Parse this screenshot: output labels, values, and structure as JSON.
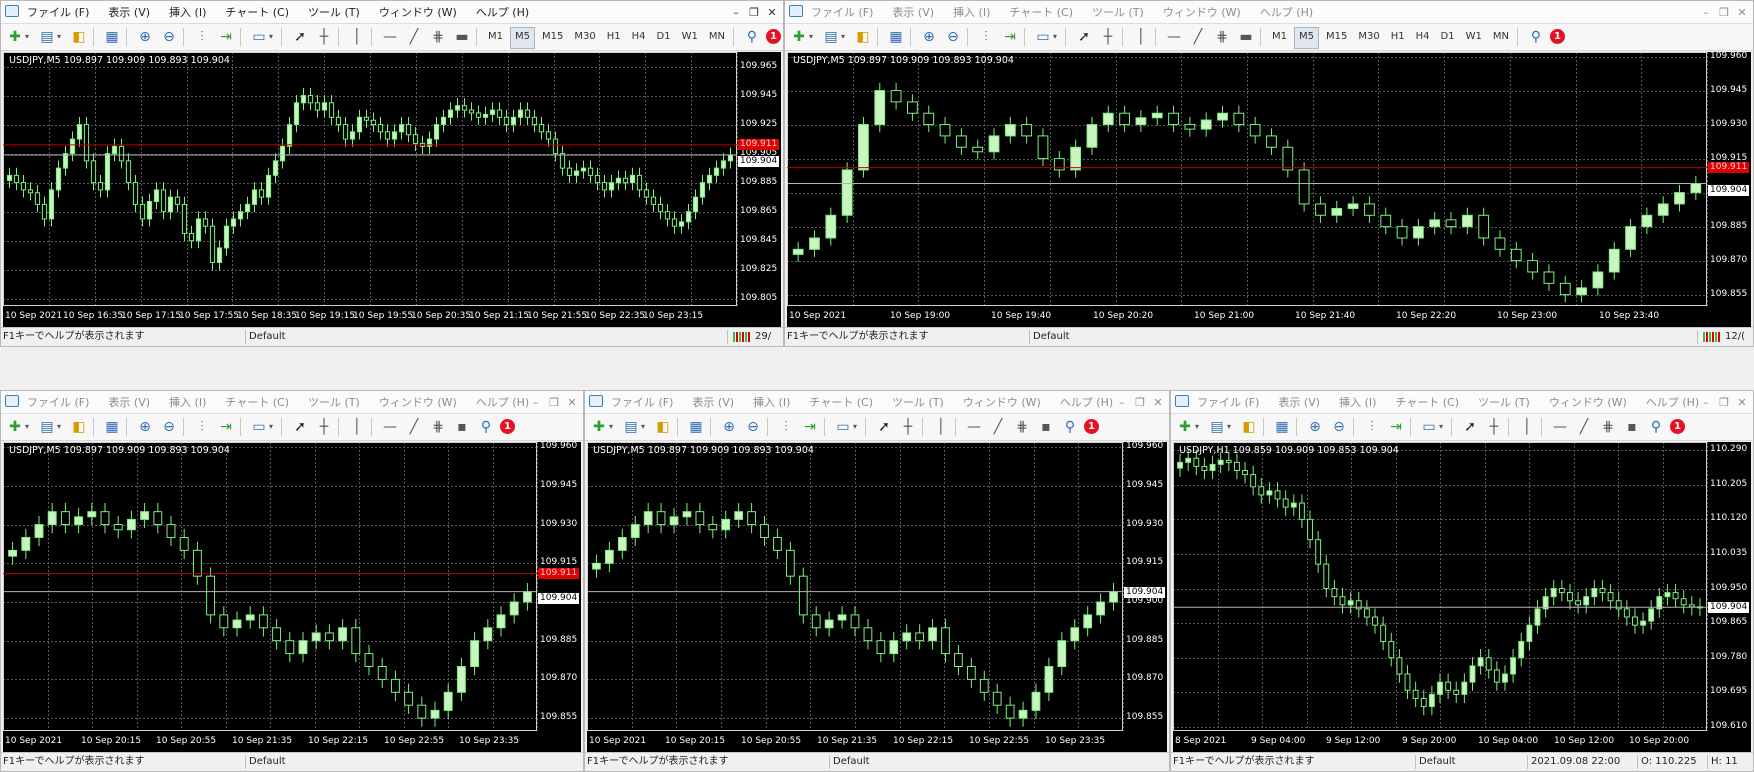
{
  "windows": [
    {
      "id": "w1",
      "active": true,
      "menu": [
        "ファイル (F)",
        "表示 (V)",
        "挿入 (I)",
        "チャート (C)",
        "ツール (T)",
        "ウィンドウ (W)",
        "ヘルプ (H)"
      ],
      "win_buttons": [
        "–",
        "❐",
        "✕"
      ],
      "timeframes": [
        "M1",
        "M5",
        "M15",
        "M30",
        "H1",
        "H4",
        "D1",
        "W1",
        "MN"
      ],
      "selected_timeframe": "M5",
      "alert_count": "1",
      "chart": {
        "symbol_line": "USDJPY,M5  109.897 109.909 109.893 109.904",
        "price_ticks": [
          "109.965",
          "109.945",
          "109.925",
          "109.905",
          "109.885",
          "109.865",
          "109.845",
          "109.825",
          "109.805"
        ],
        "price_min": 109.8,
        "price_max": 109.975,
        "time_labels": [
          "10 Sep 2021",
          "10 Sep 16:35",
          "10 Sep 17:15",
          "10 Sep 17:55",
          "10 Sep 18:35",
          "10 Sep 19:15",
          "10 Sep 19:55",
          "10 Sep 20:35",
          "10 Sep 21:15",
          "10 Sep 21:55",
          "10 Sep 22:35",
          "10 Sep 23:15"
        ],
        "ask_price": "109.911",
        "bid_price": "109.904",
        "ask_value": 109.911,
        "bid_value": 109.904,
        "series_closes": [
          109.89,
          109.885,
          109.88,
          109.878,
          109.87,
          109.86,
          109.88,
          109.895,
          109.905,
          109.915,
          109.925,
          109.9,
          109.885,
          109.88,
          109.905,
          109.91,
          109.9,
          109.885,
          109.87,
          109.86,
          109.872,
          109.88,
          109.865,
          109.875,
          109.87,
          109.85,
          109.845,
          109.86,
          109.855,
          109.83,
          109.84,
          109.855,
          109.86,
          109.865,
          109.87,
          109.88,
          109.875,
          109.89,
          109.9,
          109.91,
          109.925,
          109.94,
          109.945,
          109.94,
          109.935,
          109.94,
          109.93,
          109.925,
          109.915,
          109.92,
          109.93,
          109.928,
          109.925,
          109.92,
          109.915,
          109.92,
          109.925,
          109.918,
          109.912,
          109.91,
          109.915,
          109.925,
          109.93,
          109.935,
          109.938,
          109.935,
          109.933,
          109.93,
          109.932,
          109.935,
          109.93,
          109.925,
          109.93,
          109.935,
          109.93,
          109.925,
          109.92,
          109.915,
          109.905,
          109.895,
          109.89,
          109.893,
          109.895,
          109.89,
          109.885,
          109.88,
          109.885,
          109.888,
          109.885,
          109.89,
          109.88,
          109.875,
          109.87,
          109.865,
          109.86,
          109.855,
          109.858,
          109.865,
          109.875,
          109.885,
          109.89,
          109.895,
          109.9,
          109.904
        ],
        "grid_cols": 16,
        "grid_rows": 9
      },
      "status": {
        "help": "F1キーでヘルプが表示されます",
        "profile": "Default",
        "conn": "29/"
      }
    },
    {
      "id": "w2",
      "active": false,
      "menu": [
        "ファイル (F)",
        "表示 (V)",
        "挿入 (I)",
        "チャート (C)",
        "ツール (T)",
        "ウィンドウ (W)",
        "ヘルプ (H)"
      ],
      "win_buttons": [
        "–",
        "❐",
        "✕"
      ],
      "timeframes": [
        "M1",
        "M5",
        "M15",
        "M30",
        "H1",
        "H4",
        "D1",
        "W1",
        "MN"
      ],
      "selected_timeframe": "M5",
      "alert_count": "1",
      "chart": {
        "symbol_line": "USDJPY,M5  109.897 109.909 109.893 109.904",
        "price_ticks": [
          "109.960",
          "109.945",
          "109.930",
          "109.915",
          "109.900",
          "109.885",
          "109.870",
          "109.855"
        ],
        "price_min": 109.85,
        "price_max": 109.962,
        "time_labels": [
          "10 Sep 2021",
          "10 Sep 19:00",
          "10 Sep 19:40",
          "10 Sep 20:20",
          "10 Sep 21:00",
          "10 Sep 21:40",
          "10 Sep 22:20",
          "10 Sep 23:00",
          "10 Sep 23:40"
        ],
        "ask_price": "109.911",
        "bid_price": "109.904",
        "ask_value": 109.911,
        "bid_value": 109.904,
        "series_closes": [
          109.875,
          109.88,
          109.89,
          109.91,
          109.93,
          109.945,
          109.94,
          109.935,
          109.93,
          109.925,
          109.92,
          109.918,
          109.925,
          109.93,
          109.925,
          109.915,
          109.91,
          109.92,
          109.93,
          109.935,
          109.93,
          109.933,
          109.935,
          109.93,
          109.928,
          109.932,
          109.935,
          109.93,
          109.925,
          109.92,
          109.91,
          109.895,
          109.89,
          109.893,
          109.895,
          109.89,
          109.885,
          109.88,
          109.885,
          109.888,
          109.885,
          109.89,
          109.88,
          109.875,
          109.87,
          109.865,
          109.86,
          109.855,
          109.858,
          109.865,
          109.875,
          109.885,
          109.89,
          109.895,
          109.9,
          109.904
        ],
        "grid_cols": 14,
        "grid_rows": 8
      },
      "status": {
        "help": "F1キーでヘルプが表示されます",
        "profile": "Default",
        "conn": "12/("
      }
    },
    {
      "id": "w3",
      "active": false,
      "menu": [
        "ファイル (F)",
        "表示 (V)",
        "挿入 (I)",
        "チャート (C)",
        "ツール (T)",
        "ウィンドウ (W)",
        "ヘルプ (H)"
      ],
      "win_buttons": [
        "–",
        "❐",
        "✕"
      ],
      "timeframes": [],
      "selected_timeframe": "",
      "alert_count": "1",
      "chart": {
        "symbol_line": "USDJPY,M5  109.897 109.909 109.893 109.904",
        "price_ticks": [
          "109.960",
          "109.945",
          "109.930",
          "109.915",
          "109.900",
          "109.885",
          "109.870",
          "109.855"
        ],
        "price_min": 109.85,
        "price_max": 109.962,
        "time_labels": [
          "10 Sep 2021",
          "10 Sep 20:15",
          "10 Sep 20:55",
          "10 Sep 21:35",
          "10 Sep 22:15",
          "10 Sep 22:55",
          "10 Sep 23:35"
        ],
        "ask_price": "109.911",
        "bid_price": "109.904",
        "ask_value": 109.911,
        "bid_value": 109.904,
        "series_closes": [
          109.92,
          109.925,
          109.93,
          109.935,
          109.93,
          109.933,
          109.935,
          109.93,
          109.928,
          109.932,
          109.935,
          109.93,
          109.925,
          109.92,
          109.91,
          109.895,
          109.89,
          109.893,
          109.895,
          109.89,
          109.885,
          109.88,
          109.885,
          109.888,
          109.885,
          109.89,
          109.88,
          109.875,
          109.87,
          109.865,
          109.86,
          109.855,
          109.858,
          109.865,
          109.875,
          109.885,
          109.89,
          109.895,
          109.9,
          109.904
        ],
        "grid_cols": 12,
        "grid_rows": 8
      },
      "status": {
        "help": "F1キーでヘルプが表示されます",
        "profile": "Default",
        "conn": ""
      }
    },
    {
      "id": "w4",
      "active": false,
      "menu": [
        "ファイル (F)",
        "表示 (V)",
        "挿入 (I)",
        "チャート (C)",
        "ツール (T)",
        "ウィンドウ (W)",
        "ヘルプ (H)"
      ],
      "win_buttons": [
        "–",
        "❐",
        "✕"
      ],
      "timeframes": [],
      "selected_timeframe": "",
      "alert_count": "1",
      "chart": {
        "symbol_line": "USDJPY,M5   109.897 109.909 109.893 109.904",
        "price_ticks": [
          "109.960",
          "109.945",
          "109.930",
          "109.915",
          "109.900",
          "109.885",
          "109.870",
          "109.855"
        ],
        "price_min": 109.85,
        "price_max": 109.962,
        "time_labels": [
          "10 Sep 2021",
          "10 Sep 20:15",
          "10 Sep 20:55",
          "10 Sep 21:35",
          "10 Sep 22:15",
          "10 Sep 22:55",
          "10 Sep 23:35"
        ],
        "ask_price": "",
        "bid_price": "109.904",
        "ask_value": null,
        "bid_value": 109.904,
        "series_closes": [
          109.915,
          109.92,
          109.925,
          109.93,
          109.935,
          109.93,
          109.933,
          109.935,
          109.93,
          109.928,
          109.932,
          109.935,
          109.93,
          109.925,
          109.92,
          109.91,
          109.895,
          109.89,
          109.893,
          109.895,
          109.89,
          109.885,
          109.88,
          109.885,
          109.888,
          109.885,
          109.89,
          109.88,
          109.875,
          109.87,
          109.865,
          109.86,
          109.855,
          109.858,
          109.865,
          109.875,
          109.885,
          109.89,
          109.895,
          109.9,
          109.904
        ],
        "grid_cols": 12,
        "grid_rows": 8
      },
      "status": {
        "help": "F1キーでヘルプが表示されます",
        "profile": "Default",
        "conn": ""
      }
    },
    {
      "id": "w5",
      "active": false,
      "menu": [
        "ファイル (F)",
        "表示 (V)",
        "挿入 (I)",
        "チャート (C)",
        "ツール (T)",
        "ウィンドウ (W)",
        "ヘルプ (H)"
      ],
      "win_buttons": [
        "–",
        "❐",
        "✕"
      ],
      "timeframes": [],
      "selected_timeframe": "",
      "alert_count": "1",
      "chart": {
        "symbol_line": "USDJPY,H1  109.859 109.909 109.853 109.904",
        "price_ticks": [
          "110.290",
          "110.205",
          "110.120",
          "110.035",
          "109.950",
          "109.865",
          "109.780",
          "109.695",
          "109.610"
        ],
        "price_min": 109.6,
        "price_max": 110.31,
        "time_labels": [
          "8 Sep 2021",
          "9 Sep 04:00",
          "9 Sep 12:00",
          "9 Sep 20:00",
          "10 Sep 04:00",
          "10 Sep 12:00",
          "10 Sep 20:00"
        ],
        "ask_price": "",
        "bid_price": "109.904",
        "ask_value": null,
        "bid_value": 109.904,
        "series_closes": [
          110.26,
          110.27,
          110.25,
          110.24,
          110.255,
          110.265,
          110.26,
          110.24,
          110.23,
          110.2,
          110.18,
          110.19,
          110.17,
          110.15,
          110.16,
          110.12,
          110.07,
          110.01,
          109.95,
          109.93,
          109.91,
          109.92,
          109.9,
          109.88,
          109.86,
          109.82,
          109.78,
          109.74,
          109.7,
          109.68,
          109.66,
          109.69,
          109.72,
          109.7,
          109.69,
          109.72,
          109.76,
          109.78,
          109.75,
          109.72,
          109.74,
          109.78,
          109.82,
          109.86,
          109.9,
          109.93,
          109.95,
          109.94,
          109.92,
          109.91,
          109.93,
          109.95,
          109.94,
          109.92,
          109.9,
          109.88,
          109.86,
          109.87,
          109.9,
          109.93,
          109.94,
          109.925,
          109.91,
          109.905,
          109.904
        ],
        "grid_cols": 12,
        "grid_rows": 9
      },
      "status": {
        "help": "F1キーでヘルプが表示されます",
        "profile": "Default",
        "datetime": "2021.09.08 22:00",
        "open": "O: 110.225",
        "high": "H: 11"
      }
    }
  ],
  "colors": {
    "bull": "#c8f5c0",
    "bear": "#000000",
    "wick": "#7cf07c",
    "grid": "#5a5a5a",
    "ask_line": "#c00000",
    "bid_line": "#b4b4b4"
  }
}
